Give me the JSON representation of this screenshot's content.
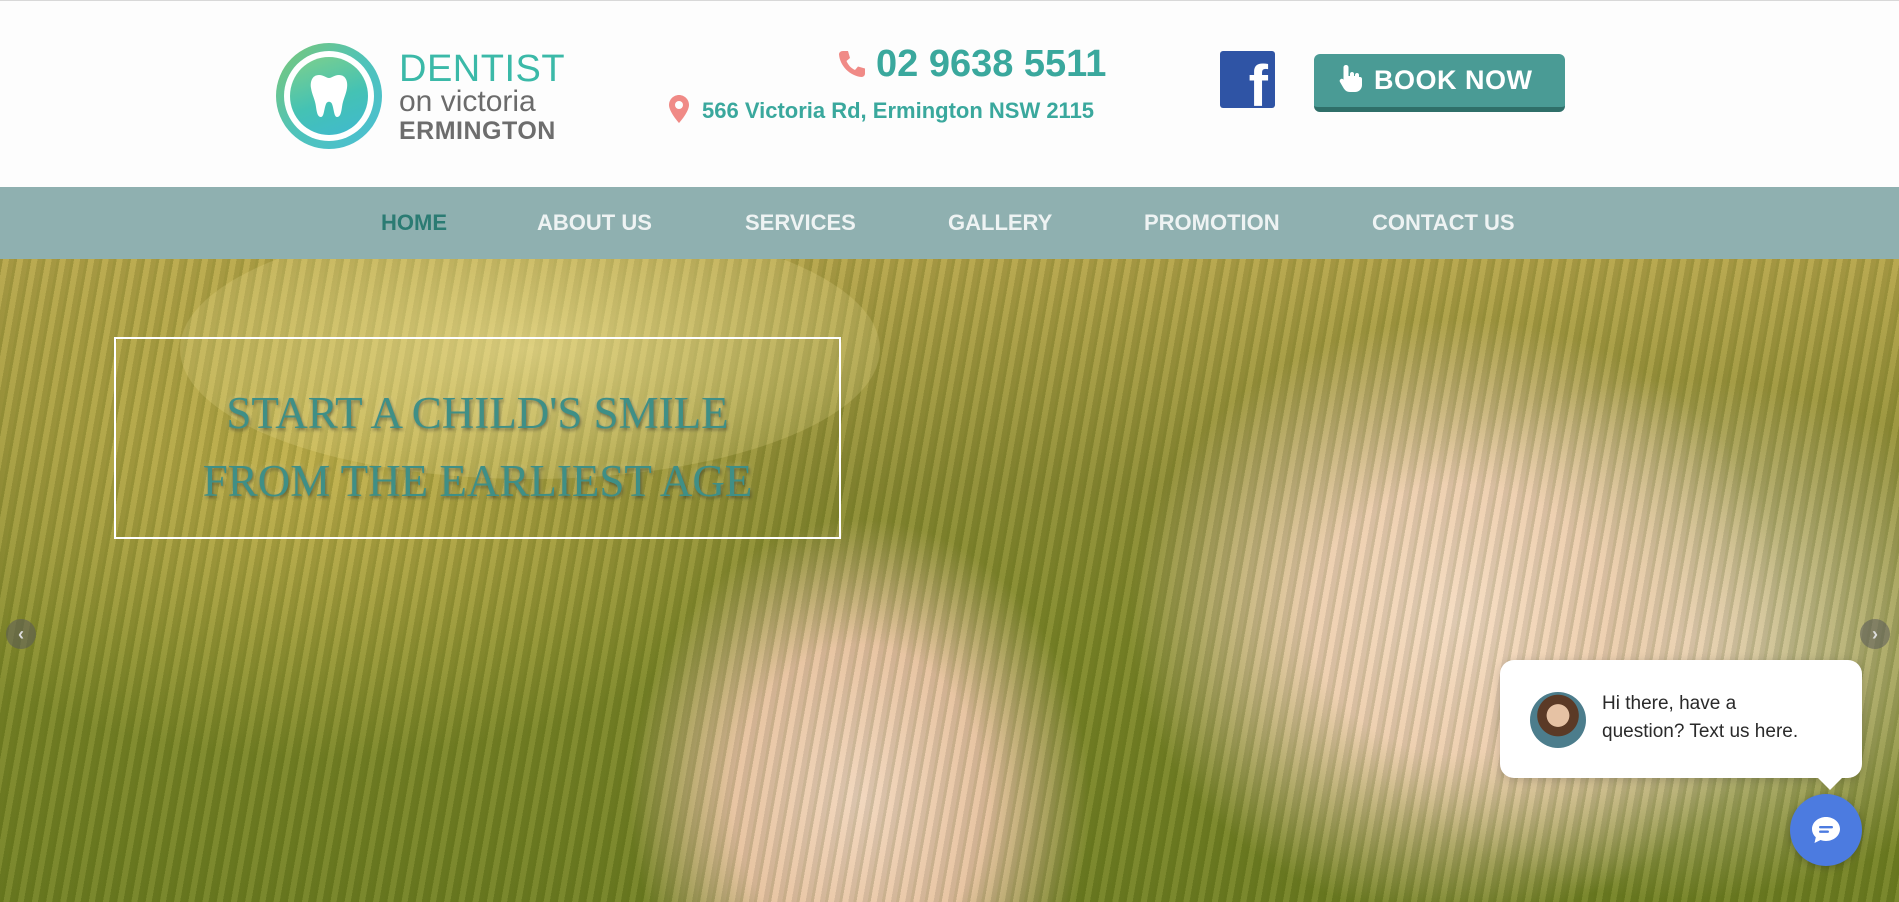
{
  "brand": {
    "line1": "DENTIST",
    "line2": "on victoria",
    "line3": "ERMINGTON"
  },
  "contact": {
    "phone": "02 9638 5511",
    "address": "566 Victoria Rd, Ermington NSW 2115"
  },
  "social": {
    "facebook_label": "f"
  },
  "cta": {
    "book_label": "BOOK NOW"
  },
  "nav": {
    "items": [
      {
        "label": "HOME",
        "active": true
      },
      {
        "label": "ABOUT US"
      },
      {
        "label": "SERVICES"
      },
      {
        "label": "GALLERY"
      },
      {
        "label": "PROMOTION"
      },
      {
        "label": "CONTACT US"
      }
    ]
  },
  "hero": {
    "headline_line1": "START A CHILD'S SMILE",
    "headline_line2": "FROM THE EARLIEST AGE"
  },
  "chat": {
    "message_line1": "Hi there, have a",
    "message_line2": "question? Text us here."
  },
  "colors": {
    "brand_teal": "#3aa89d",
    "nav_bg": "#8fb0b0",
    "book_btn": "#4a9b95",
    "facebook_blue": "#2f54a5",
    "chat_blue": "#4c7be0"
  },
  "icons": [
    "tooth-icon",
    "phone-icon",
    "location-pin-icon",
    "facebook-icon",
    "hand-pointer-icon",
    "chevron-left-icon",
    "chevron-right-icon",
    "chat-icon"
  ]
}
